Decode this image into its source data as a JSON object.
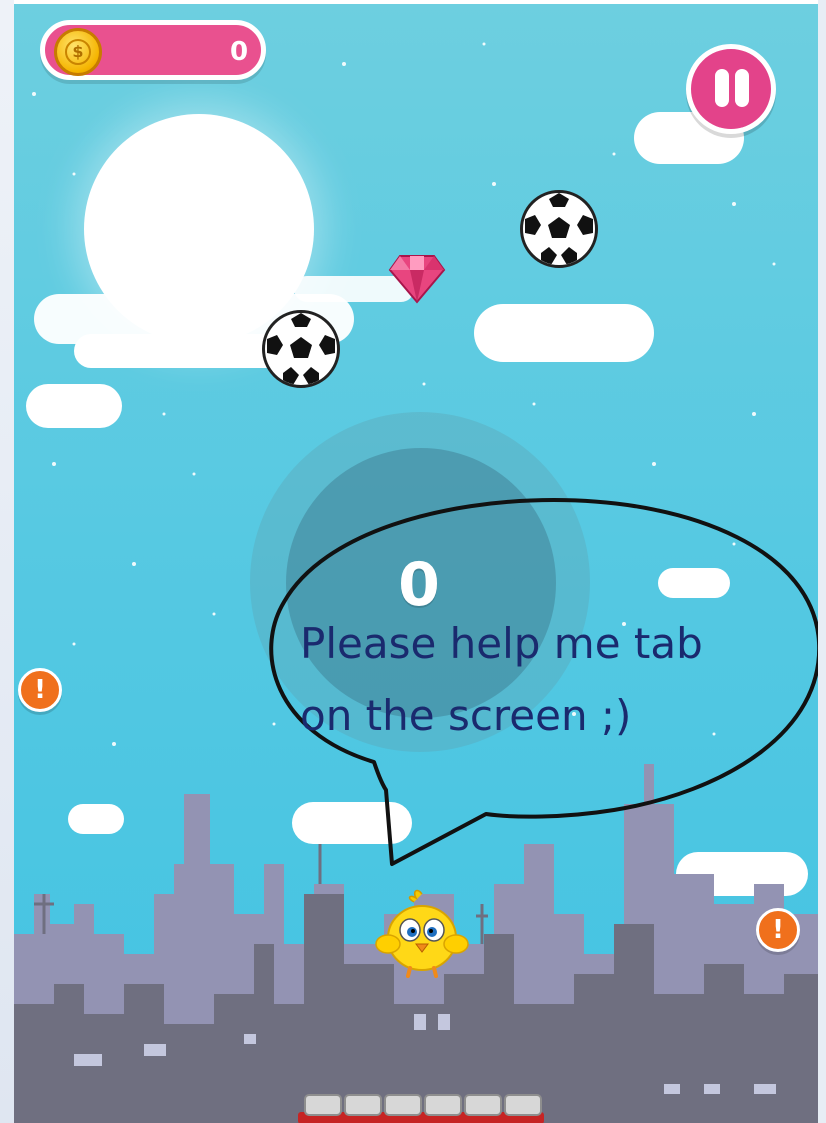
{
  "hud": {
    "coin_icon": "coin-icon",
    "coin_symbol": "$",
    "coin_count": "0",
    "pause_icon": "pause-icon"
  },
  "game": {
    "score": "0",
    "speech_line_1": "Please help me tab",
    "speech_line_2": "on the screen ;)",
    "warning_symbol": "!"
  },
  "objects": {
    "balls": [
      "soccer-ball",
      "soccer-ball"
    ],
    "gem": "pink-diamond",
    "character": "yellow-chick"
  },
  "colors": {
    "sky": "#53c8e2",
    "hud_pink": "#e9518f",
    "pause_pink": "#e3438a",
    "warning_orange": "#f0701c",
    "city_light": "#8f8fae",
    "city_dark": "#70707f",
    "speech_text": "#1a2a6e"
  }
}
